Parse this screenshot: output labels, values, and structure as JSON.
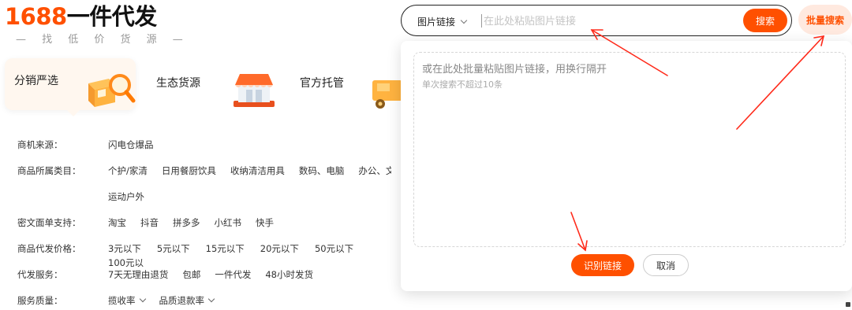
{
  "logo": {
    "number": "1688",
    "text": "一件代发",
    "tagline": "— 找 低 价 货 源 —"
  },
  "categories": [
    {
      "label": "分销严选",
      "icon": "package-magnifier-icon",
      "active": true
    },
    {
      "label": "生态货源",
      "icon": "storefront-icon",
      "active": false
    },
    {
      "label": "官方托管",
      "icon": "delivery-truck-icon",
      "active": false
    }
  ],
  "filters": {
    "source": {
      "label": "商机来源：",
      "options": [
        "闪电仓爆品"
      ]
    },
    "category": {
      "label": "商品所属类目：",
      "options": [
        "个护/家清",
        "日用餐厨饮具",
        "收纳清洁用具",
        "数码、电脑",
        "办公、文",
        "运动户外"
      ]
    },
    "platform": {
      "label": "密文面单支持：",
      "options": [
        "淘宝",
        "抖音",
        "拼多多",
        "小红书",
        "快手"
      ]
    },
    "price": {
      "label": "商品代发价格：",
      "options": [
        "3元以下",
        "5元以下",
        "15元以下",
        "20元以下",
        "50元以下",
        "100元以"
      ]
    },
    "service": {
      "label": "代发服务：",
      "options": [
        "7天无理由退货",
        "包邮",
        "一件代发",
        "48小时发货"
      ]
    },
    "quality": {
      "label": "服务质量：",
      "options": [
        "揽收率",
        "品质退款率"
      ]
    }
  },
  "search": {
    "type_label": "图片链接",
    "placeholder": "在此处粘贴图片链接",
    "button_label": "搜索",
    "batch_label": "批量搜索"
  },
  "panel": {
    "placeholder": "或在此处批量粘贴图片链接，用换行隔开",
    "hint": "单次搜索不超过10条",
    "recognize_label": "识别链接",
    "cancel_label": "取消"
  },
  "colors": {
    "accent": "#ff5000",
    "batch_bg": "#ffe9df",
    "annotation": "#ff2a1a"
  }
}
